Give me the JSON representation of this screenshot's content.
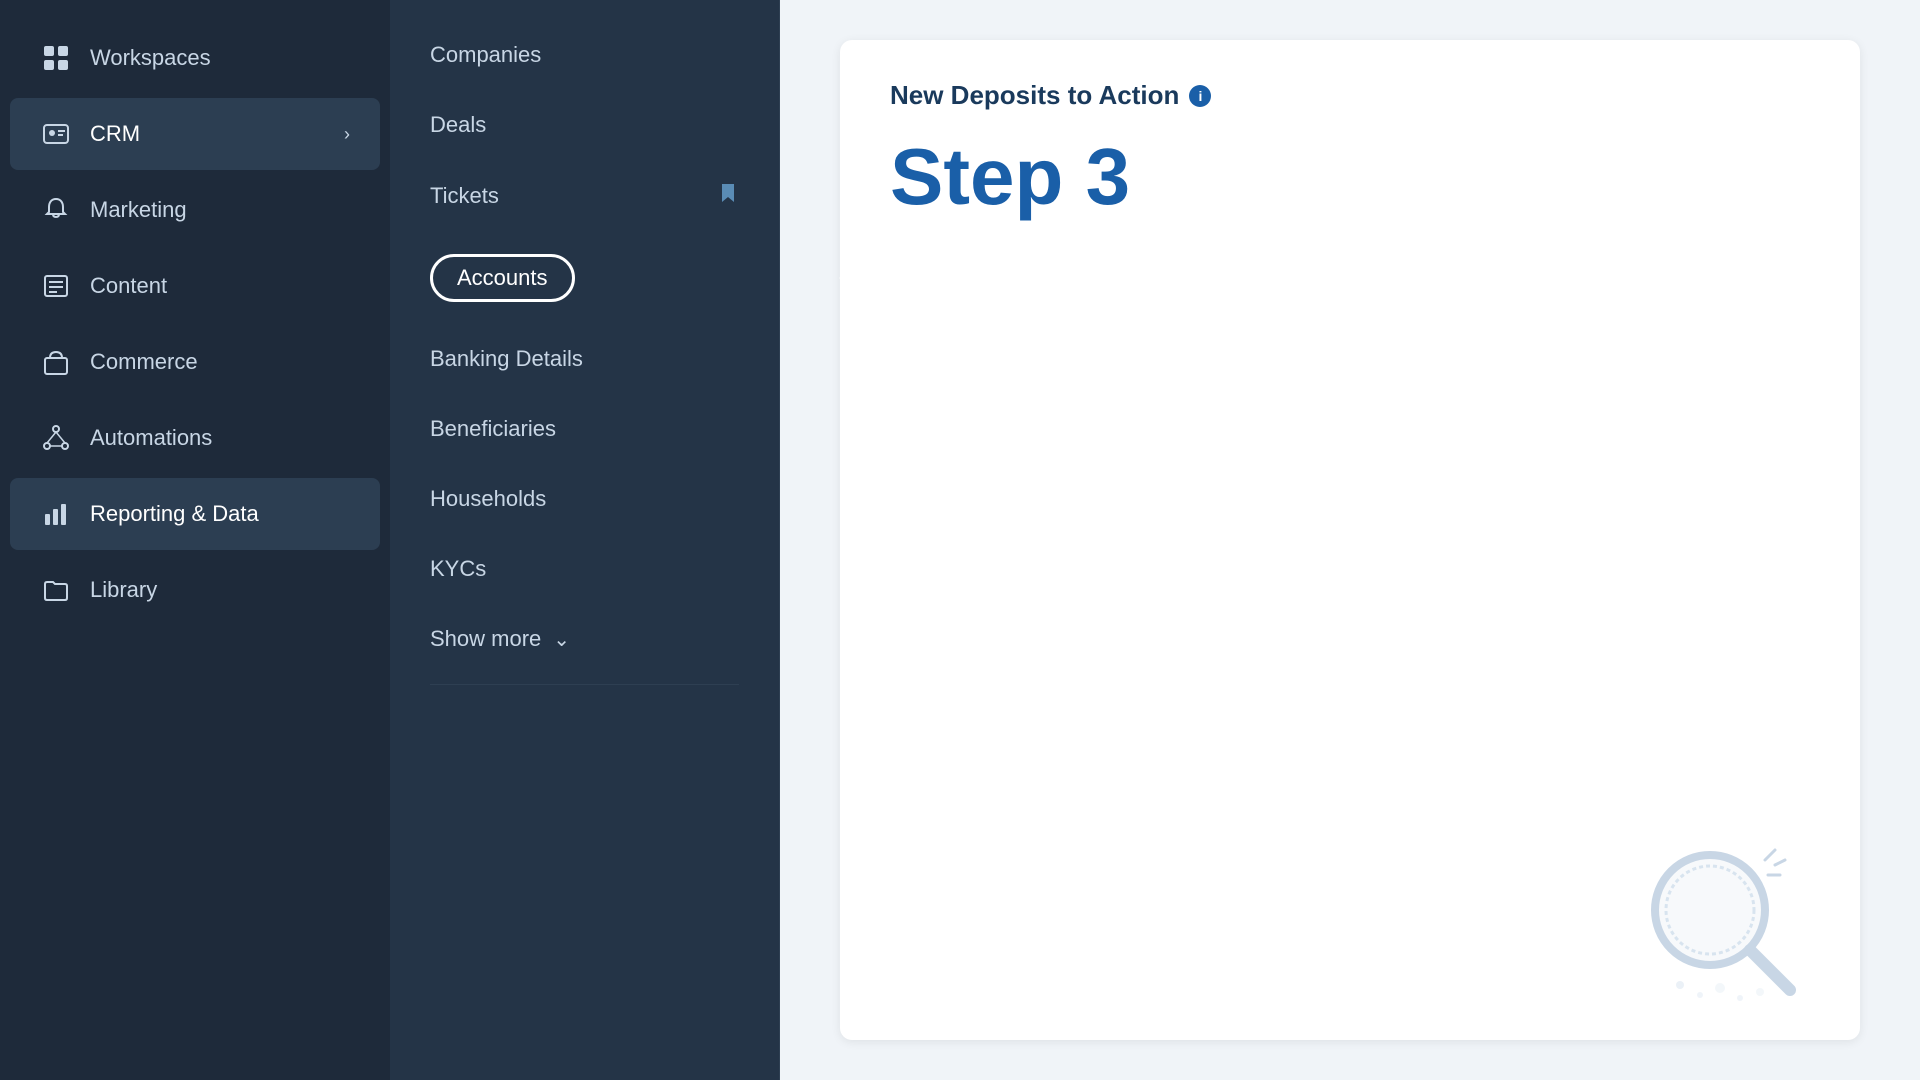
{
  "sidebar": {
    "items": [
      {
        "id": "workspaces",
        "label": "Workspaces",
        "icon": "grid",
        "active": false
      },
      {
        "id": "crm",
        "label": "CRM",
        "icon": "user-card",
        "active": true,
        "hasChevron": true
      },
      {
        "id": "marketing",
        "label": "Marketing",
        "icon": "bell",
        "active": false
      },
      {
        "id": "content",
        "label": "Content",
        "icon": "list",
        "active": false
      },
      {
        "id": "commerce",
        "label": "Commerce",
        "icon": "shop",
        "active": false
      },
      {
        "id": "automations",
        "label": "Automations",
        "icon": "nodes",
        "active": false
      },
      {
        "id": "reporting",
        "label": "Reporting & Data",
        "icon": "chart",
        "active": true
      },
      {
        "id": "library",
        "label": "Library",
        "icon": "folder",
        "active": false
      }
    ]
  },
  "submenu": {
    "items": [
      {
        "id": "companies",
        "label": "Companies",
        "hasBookmark": false
      },
      {
        "id": "deals",
        "label": "Deals",
        "hasBookmark": false
      },
      {
        "id": "tickets",
        "label": "Tickets",
        "hasBookmark": true
      },
      {
        "id": "accounts",
        "label": "Accounts",
        "highlighted": true
      },
      {
        "id": "banking-details",
        "label": "Banking Details",
        "hasBookmark": false
      },
      {
        "id": "beneficiaries",
        "label": "Beneficiaries",
        "hasBookmark": false
      },
      {
        "id": "households",
        "label": "Households",
        "hasBookmark": false
      },
      {
        "id": "kycs",
        "label": "KYCs",
        "hasBookmark": false
      }
    ],
    "showMore": "Show more"
  },
  "mainPanel": {
    "title": "New Deposits to Action",
    "infoIcon": "i",
    "stepLabel": "Step 3"
  },
  "arrow": {
    "direction": "left"
  }
}
